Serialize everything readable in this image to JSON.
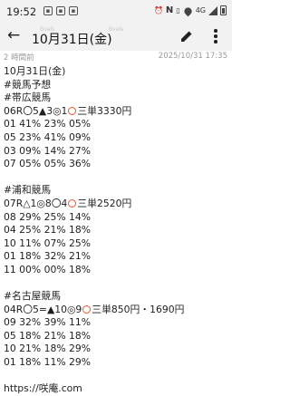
{
  "status_bar": {
    "time": "19:52",
    "network": "4G"
  },
  "app_bar": {
    "title": "10月31日(金)",
    "faint_left": "Bvals",
    "faint_right": "Bvals"
  },
  "meta": {
    "relative_time": "2 時間前",
    "timestamp": "2025/10/31 17:35"
  },
  "note": {
    "date": "10月31日(金)",
    "heading": "#競馬予想",
    "sections": [
      {
        "title": "#帯広競馬",
        "bet": {
          "race": "06R",
          "picks": "〇5▲3◎1",
          "ticket": "三単3330円"
        },
        "rows": [
          "01 41% 23% 05%",
          "05 23% 41% 09%",
          "03 09% 14% 27%",
          "07 05% 05% 36%"
        ]
      },
      {
        "title": "#浦和競馬",
        "bet": {
          "race": "07R",
          "picks": "△1◎8〇4",
          "ticket": "三単2520円"
        },
        "rows": [
          "08 29% 25% 14%",
          "04 25% 21% 18%",
          "10 11% 07% 25%",
          "01 18% 32% 21%",
          "11 00% 00% 18%"
        ]
      },
      {
        "title": "#名古屋競馬",
        "bet": {
          "race": "04R",
          "picks": "〇5=▲10◎9",
          "ticket": "三単850円・1690円"
        },
        "rows": [
          "09 32% 39% 11%",
          "05 18% 21% 18%",
          "10 21% 18% 29%",
          "01 18% 11% 29%"
        ]
      }
    ],
    "footer": "https://咲庵.com"
  },
  "colors": {
    "accent_circle": "#e4572e",
    "bar_background": "#f2f2f2"
  },
  "icons": [
    "back-arrow-icon",
    "edit-pencil-icon",
    "more-vert-icon"
  ]
}
